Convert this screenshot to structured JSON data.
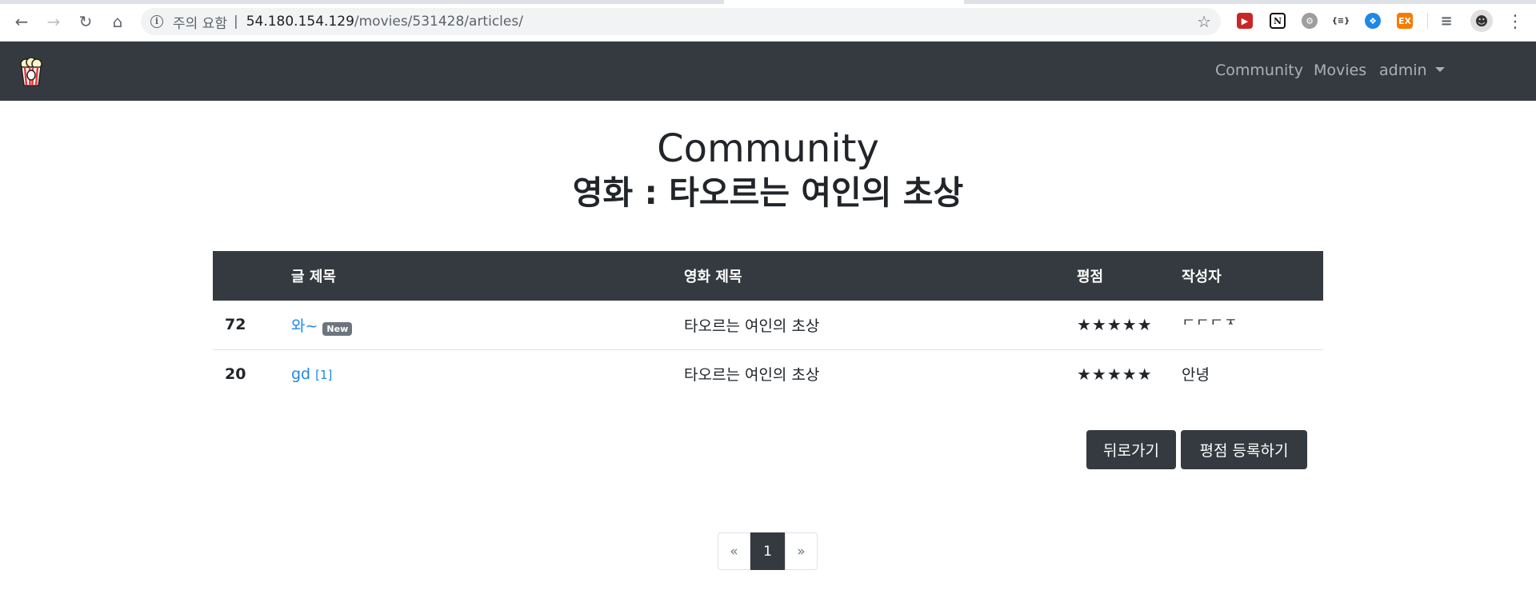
{
  "browser": {
    "address_warning": "주의 요함",
    "address_separator": "|",
    "url_host": "54.180.154.129",
    "url_path": "/movies/531428/articles/",
    "extensions": [
      "video-ext-icon",
      "notion-icon",
      "gear-ext-icon",
      "json-ext-icon",
      "globe-ext-icon",
      "ex-ext-icon"
    ],
    "ext_ex_label": "EX"
  },
  "navbar": {
    "links": {
      "community": "Community",
      "movies": "Movies",
      "user": "admin"
    }
  },
  "page": {
    "title": "Community",
    "subtitle": "영화 : 타오르는 여인의 초상"
  },
  "table": {
    "headers": {
      "num": "",
      "title": "글 제목",
      "movie": "영화 제목",
      "rating": "평점",
      "author": "작성자"
    },
    "rows": [
      {
        "num": "72",
        "title": "와~",
        "badge": "New",
        "comments": "",
        "movie": "타오르는 여인의 초상",
        "rating": "★★★★★",
        "author": "ㄷㄷㄷㅈ"
      },
      {
        "num": "20",
        "title": "gd",
        "badge": "",
        "comments": "[1]",
        "movie": "타오르는 여인의 초상",
        "rating": "★★★★★",
        "author": "안녕"
      }
    ]
  },
  "buttons": {
    "back": "뒤로가기",
    "write_review": "평점 등록하기"
  },
  "pagination": {
    "prev": "«",
    "current": "1",
    "next": "»"
  },
  "colors": {
    "navbar_bg": "#343a40",
    "link": "#1e88e5",
    "badge": "#6c757d"
  }
}
